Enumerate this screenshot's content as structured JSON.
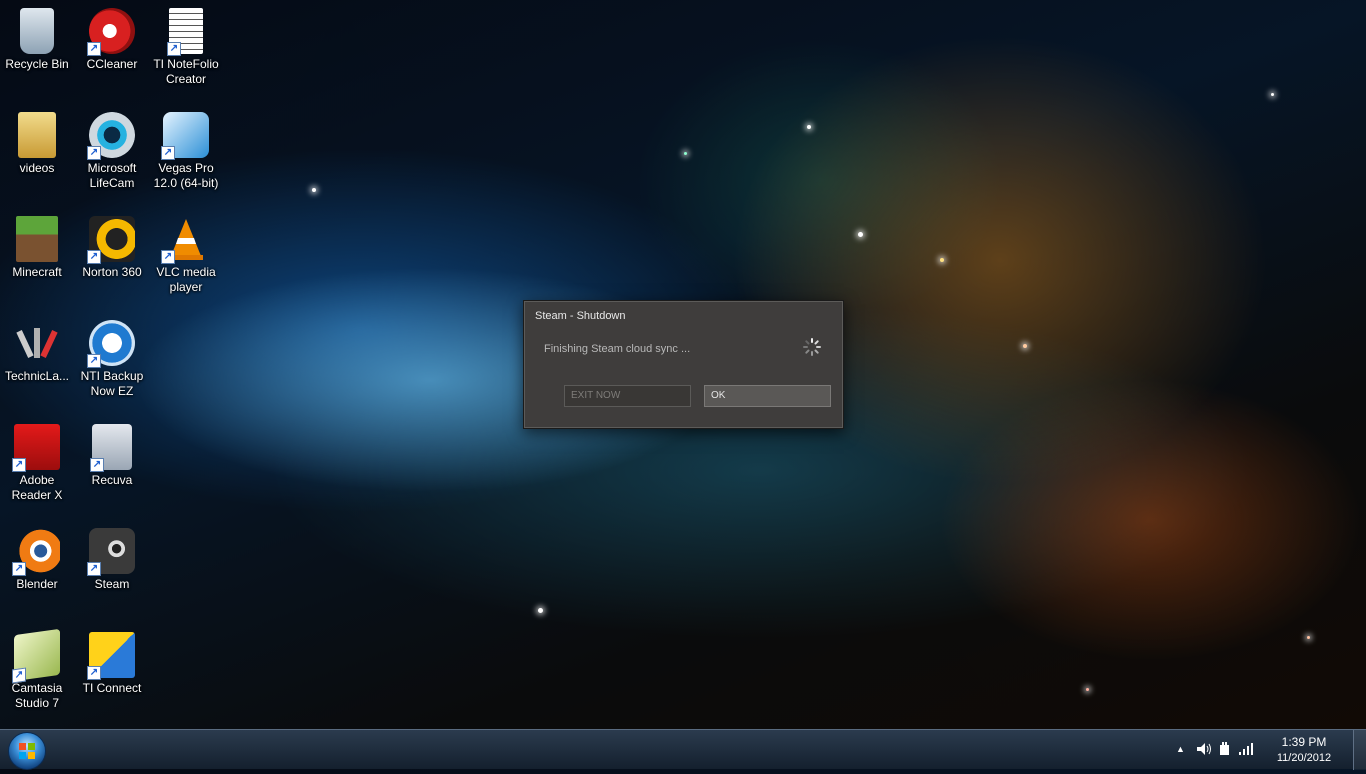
{
  "desktop": {
    "icons": [
      {
        "label": "Recycle Bin",
        "icon": "recycle-bin-icon"
      },
      {
        "label": "CCleaner",
        "icon": "ccleaner-icon"
      },
      {
        "label": "TI NoteFolio Creator",
        "icon": "notefolio-icon"
      },
      {
        "label": "videos",
        "icon": "folder-icon"
      },
      {
        "label": "Microsoft LifeCam",
        "icon": "lifecam-icon"
      },
      {
        "label": "Vegas Pro 12.0 (64-bit)",
        "icon": "vegas-icon"
      },
      {
        "label": "Minecraft",
        "icon": "minecraft-icon"
      },
      {
        "label": "Norton 360",
        "icon": "norton-icon"
      },
      {
        "label": "VLC media player",
        "icon": "vlc-icon"
      },
      {
        "label": "TechnicLa...",
        "icon": "technic-launcher-icon"
      },
      {
        "label": "NTI Backup Now EZ",
        "icon": "nti-backup-icon"
      },
      {
        "label": "Adobe Reader X",
        "icon": "adobe-reader-icon"
      },
      {
        "label": "Recuva",
        "icon": "recuva-icon"
      },
      {
        "label": "Blender",
        "icon": "blender-icon"
      },
      {
        "label": "Steam",
        "icon": "steam-icon"
      },
      {
        "label": "Camtasia Studio 7",
        "icon": "camtasia-icon"
      },
      {
        "label": "TI Connect",
        "icon": "ti-connect-icon"
      }
    ]
  },
  "dialog": {
    "title": "Steam - Shutdown",
    "message": "Finishing Steam cloud sync ...",
    "exit_label": "EXIT NOW",
    "ok_label": "OK"
  },
  "taskbar": {
    "tray_arrow": "▲",
    "time": "1:39 PM",
    "date": "11/20/2012"
  }
}
